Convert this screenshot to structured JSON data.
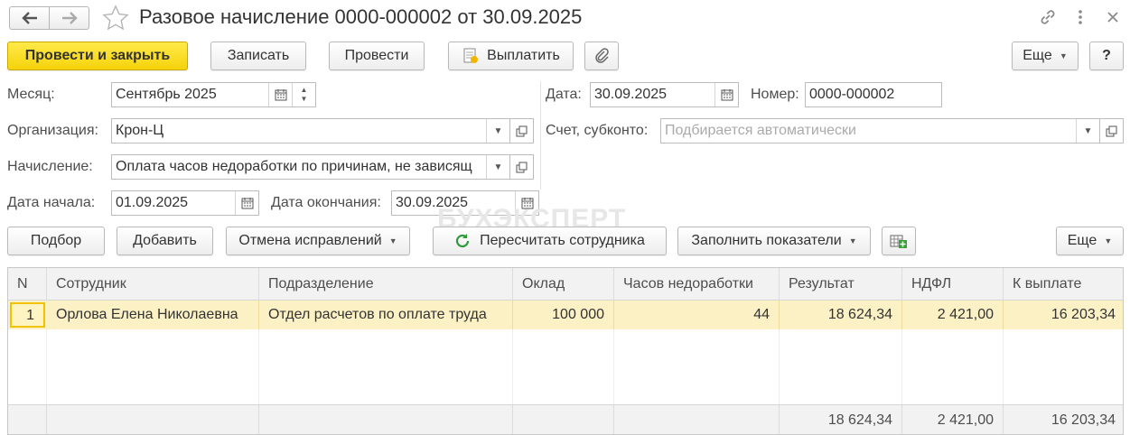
{
  "window": {
    "title": "Разовое начисление 0000-000002 от 30.09.2025"
  },
  "colors": {
    "accent": "#f5d20a",
    "selected_row": "#fbf1c5",
    "header_bg": "#f2f2f2"
  },
  "toolbar": {
    "post_close": "Провести и закрыть",
    "save": "Записать",
    "post": "Провести",
    "pay": "Выплатить",
    "more": "Еще",
    "help": "?"
  },
  "form": {
    "month_label": "Месяц:",
    "month_value": "Сентябрь 2025",
    "date_label": "Дата:",
    "date_value": "30.09.2025",
    "number_label": "Номер:",
    "number_value": "0000-000002",
    "org_label": "Организация:",
    "org_value": "Крон-Ц",
    "account_label": "Счет, субконто:",
    "account_placeholder": "Подбирается автоматически",
    "accrual_label": "Начисление:",
    "accrual_value": "Оплата часов недоработки по причинам, не зависящ",
    "start_label": "Дата начала:",
    "start_value": "01.09.2025",
    "end_label": "Дата окончания:",
    "end_value": "30.09.2025"
  },
  "watermark": "БУХЭКСПЕРТ",
  "table_toolbar": {
    "select": "Подбор",
    "add": "Добавить",
    "cancel_corrections": "Отмена исправлений",
    "recalc": "Пересчитать сотрудника",
    "fill": "Заполнить показатели",
    "more": "Еще"
  },
  "table": {
    "columns": [
      "N",
      "Сотрудник",
      "Подразделение",
      "Оклад",
      "Часов недоработки",
      "Результат",
      "НДФЛ",
      "К выплате"
    ],
    "rows": [
      {
        "n": "1",
        "employee": "Орлова Елена Николаевна",
        "department": "Отдел расчетов по оплате труда",
        "salary": "100 000",
        "hours": "44",
        "result": "18 624,34",
        "ndfl": "2 421,00",
        "payout": "16 203,34"
      }
    ],
    "totals": {
      "result": "18 624,34",
      "ndfl": "2 421,00",
      "payout": "16 203,34"
    }
  }
}
